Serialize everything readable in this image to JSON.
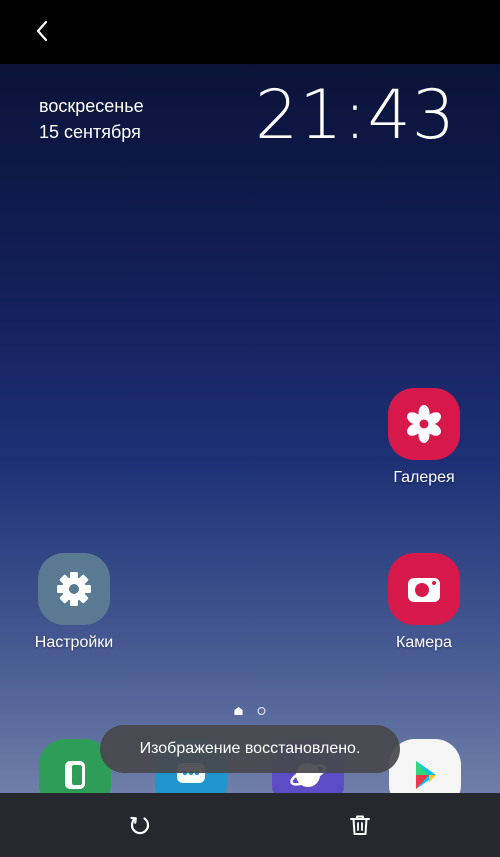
{
  "status": {
    "day": "воскресенье",
    "date": "15 сентября",
    "time": "21:43"
  },
  "apps": {
    "gallery": {
      "label": "Галерея",
      "color": "#d6184a"
    },
    "camera": {
      "label": "Камера",
      "color": "#d6184a"
    },
    "settings": {
      "label": "Настройки",
      "color": "#5a7a94"
    }
  },
  "dock": {
    "phone_color": "#2e9d57",
    "messages_color": "#1e96cc",
    "internet_color": "#5d4dc4",
    "playstore_color": "#f5f5f5"
  },
  "pager": {
    "count": 2,
    "current": 1
  },
  "toast": {
    "text": "Изображение восстановлено."
  },
  "toolbar": {
    "restore_icon": "restore-icon",
    "delete_icon": "trash-icon"
  }
}
